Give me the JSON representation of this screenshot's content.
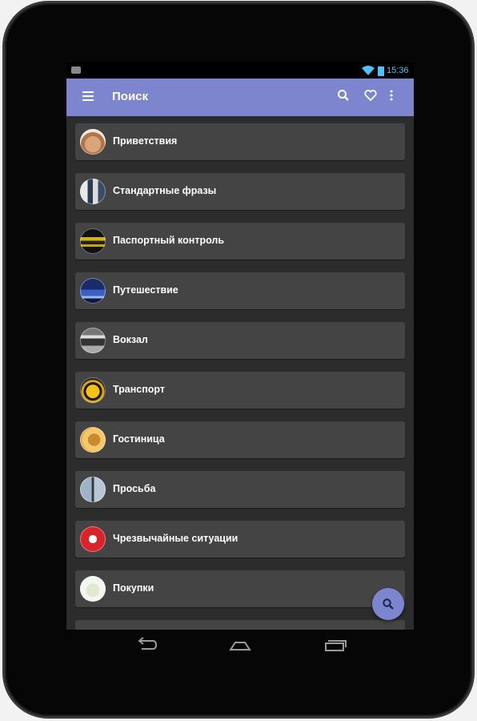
{
  "status_bar": {
    "time": "15:36",
    "icons": [
      "notification-icon",
      "wifi-icon",
      "battery-icon"
    ],
    "accent": "#4fc3f7"
  },
  "app_bar": {
    "title": "Поиск",
    "background": "#7c85cd",
    "actions": [
      "search-icon",
      "heart-icon",
      "more-vert-icon"
    ]
  },
  "categories": [
    {
      "label": "Приветствия",
      "icon": "handshake-thumbnail"
    },
    {
      "label": "Стандартные фразы",
      "icon": "people-thumbnail"
    },
    {
      "label": "Паспортный контроль",
      "icon": "passport-control-thumbnail"
    },
    {
      "label": "Путешествие",
      "icon": "city-night-thumbnail"
    },
    {
      "label": "Вокзал",
      "icon": "train-station-thumbnail"
    },
    {
      "label": "Транспорт",
      "icon": "taxi-thumbnail"
    },
    {
      "label": "Гостиница",
      "icon": "hotel-bell-thumbnail"
    },
    {
      "label": "Просьба",
      "icon": "signpost-thumbnail"
    },
    {
      "label": "Чрезвычайные ситуации",
      "icon": "first-aid-thumbnail"
    },
    {
      "label": "Покупки",
      "icon": "shopping-thumbnail"
    }
  ],
  "fab": {
    "icon": "search-icon",
    "background": "#7c85cd"
  },
  "nav_bar": [
    "back-icon",
    "home-icon",
    "recent-apps-icon"
  ]
}
